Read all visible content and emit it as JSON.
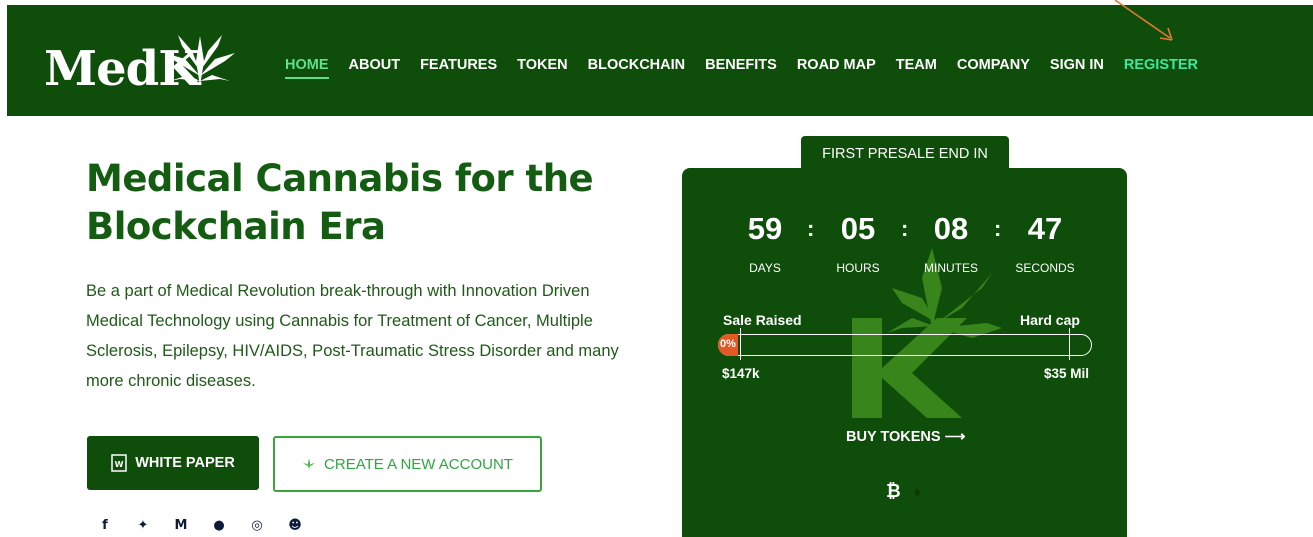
{
  "brand": {
    "logo_text": "MedK"
  },
  "nav": {
    "items": [
      "HOME",
      "ABOUT",
      "FEATURES",
      "TOKEN",
      "BLOCKCHAIN",
      "BENEFITS",
      "ROAD MAP",
      "TEAM",
      "COMPANY",
      "SIGN IN",
      "REGISTER"
    ],
    "active": "HOME"
  },
  "hero": {
    "title": "Medical Cannabis for the Blockchain Era",
    "description": "Be a part of Medical Revolution break-through with Innovation Driven Medical Technology using Cannabis for Treatment of Cancer, Multiple Sclerosis, Epilepsy, HIV/AIDS, Post-Traumatic Stress Disorder and many more chronic diseases.",
    "white_paper_label": "WHITE PAPER",
    "create_account_label": "CREATE A NEW ACCOUNT"
  },
  "socials": [
    "facebook-icon",
    "twitter-icon",
    "medium-icon",
    "telegram-icon",
    "steemit-icon",
    "reddit-icon"
  ],
  "presale": {
    "tab_label": "FIRST PRESALE END IN",
    "countdown": [
      {
        "value": "59",
        "label": "DAYS"
      },
      {
        "value": "05",
        "label": "HOURS"
      },
      {
        "value": "08",
        "label": "MINUTES"
      },
      {
        "value": "47",
        "label": "SECONDS"
      }
    ],
    "separator": ":",
    "sale_raised_label": "Sale Raised",
    "hard_cap_label": "Hard cap",
    "progress_text": "0%",
    "progress_percent": 0,
    "raised_amount": "$147k",
    "hard_cap_amount": "$35 Mil",
    "buy_label": "BUY TOKENS",
    "buy_arrow": "⟶",
    "crypto_bitcoin": "₿",
    "crypto_ethereum": "♦"
  },
  "colors": {
    "brand_green": "#0f4d0a",
    "accent_green": "#3ee79b",
    "progress_orange": "#e25a23"
  }
}
